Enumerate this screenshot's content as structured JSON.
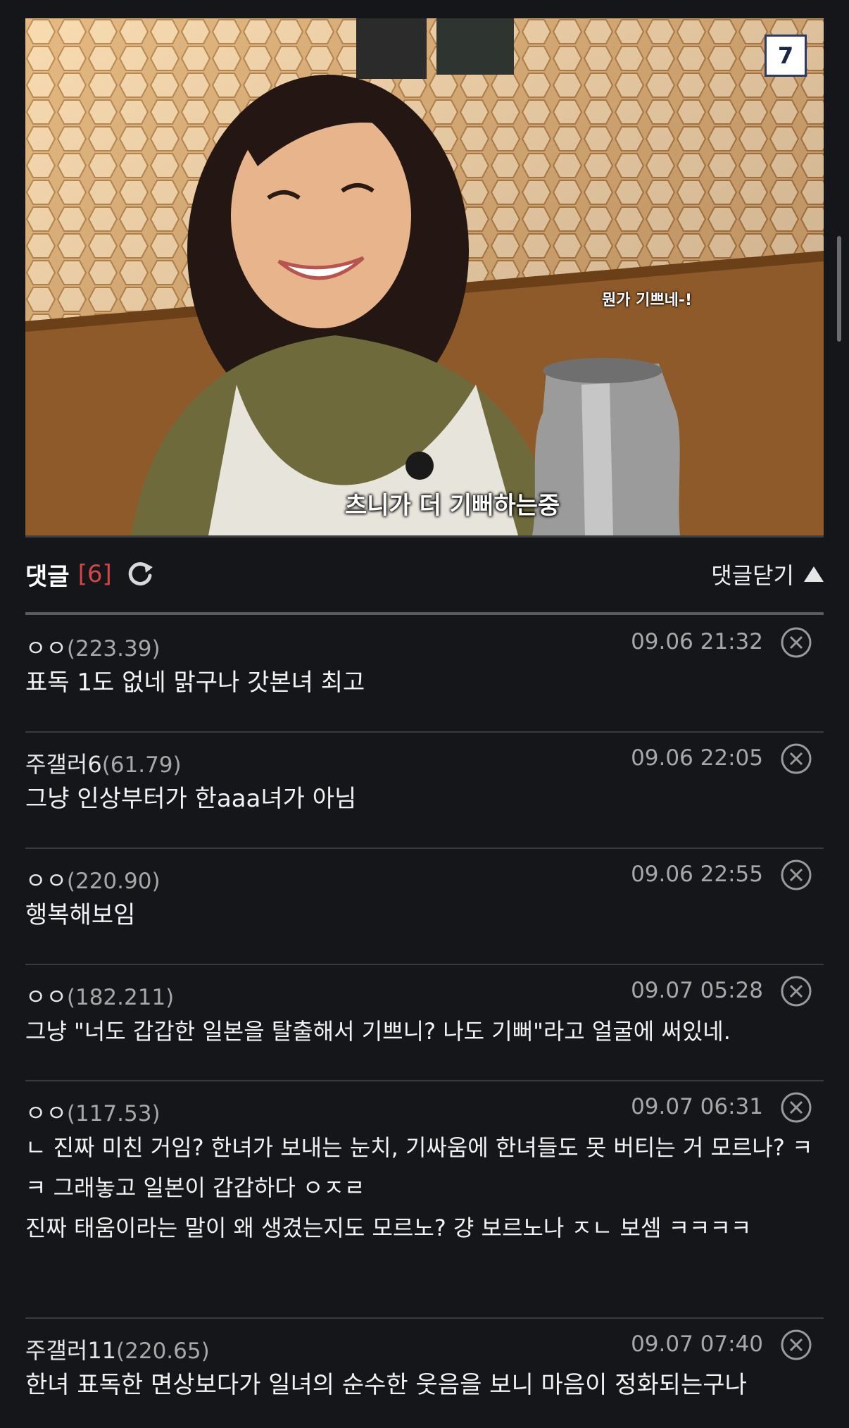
{
  "image": {
    "page_badge": "7",
    "subtitle_small": "뭔가 기쁘네-!",
    "subtitle_big": "츠니가 더 기뻐하는중"
  },
  "comments_header": {
    "title": "댓글",
    "count": "[6]",
    "close_label": "댓글닫기"
  },
  "comments": [
    {
      "author": "ㅇㅇ",
      "ip": "(223.39)",
      "date": "09.06 21:32",
      "text": "표독 1도 없네 맑구나 갓본녀 최고"
    },
    {
      "author": "주갤러6",
      "ip": "(61.79)",
      "date": "09.06 22:05",
      "text": "그냥 인상부터가 한aaa녀가 아님"
    },
    {
      "author": "ㅇㅇ",
      "ip": "(220.90)",
      "date": "09.06 22:55",
      "text": "행복해보임"
    },
    {
      "author": "ㅇㅇ",
      "ip": "(182.211)",
      "date": "09.07 05:28",
      "text": "그냥 \"너도 갑갑한 일본을 탈출해서 기쁘니? 나도 기뻐\"라고 얼굴에 써있네."
    },
    {
      "author": "ㅇㅇ",
      "ip": "(117.53)",
      "date": "09.07 06:31",
      "text": "ㄴ 진짜 미친 거임? 한녀가 보내는 눈치, 기싸움에 한녀들도 못 버티는 거 모르나? ㅋㅋ 그래놓고 일본이 갑갑하다 ㅇㅈㄹ\n진짜 태움이라는 말이 왜 생겼는지도 모르노? 걍 보르노나 ㅈㄴ 보셈 ㅋㅋㅋㅋ"
    },
    {
      "author": "주갤러11",
      "ip": "(220.65)",
      "date": "09.07 07:40",
      "text": "한녀 표독한 면상보다가 일녀의 순수한 웃음을 보니 마음이 정화되는구나"
    }
  ],
  "colors": {
    "background": "#151619",
    "comment_count": "#d64545"
  }
}
